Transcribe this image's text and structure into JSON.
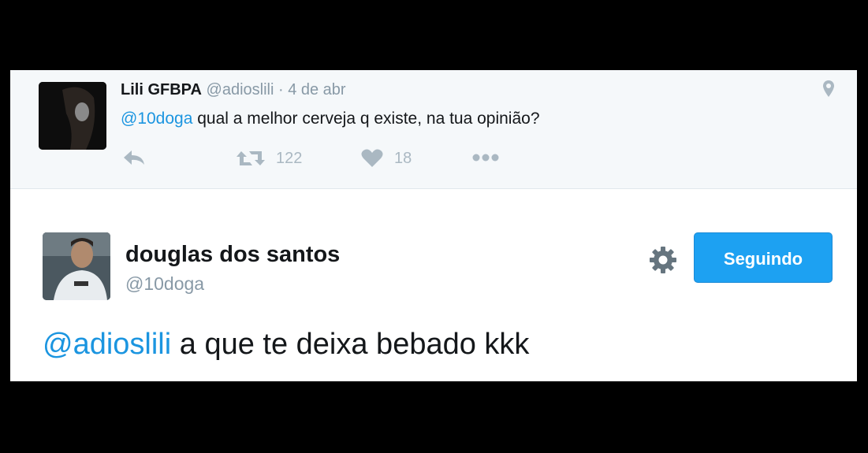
{
  "parent_tweet": {
    "name": "Lili GFBPA",
    "handle": "@adioslili",
    "separator": " · ",
    "date": "4 de abr",
    "mention": "@10doga",
    "text": " qual a melhor cerveja q existe, na tua opinião?",
    "retweet_count": "122",
    "like_count": "18"
  },
  "reply_tweet": {
    "name": "douglas dos santos",
    "handle": "@10doga",
    "follow_label": "Seguindo",
    "mention": "@adioslili",
    "text": " a que te deixa bebado kkk"
  },
  "icons": {
    "location": "location-pin-icon",
    "reply": "reply-icon",
    "retweet": "retweet-icon",
    "like": "heart-icon",
    "more": "more-dots-icon",
    "settings": "gear-icon"
  },
  "colors": {
    "link": "#1b95e0",
    "button": "#1da1f2",
    "muted": "#8899a6",
    "icon": "#aab8c2"
  }
}
